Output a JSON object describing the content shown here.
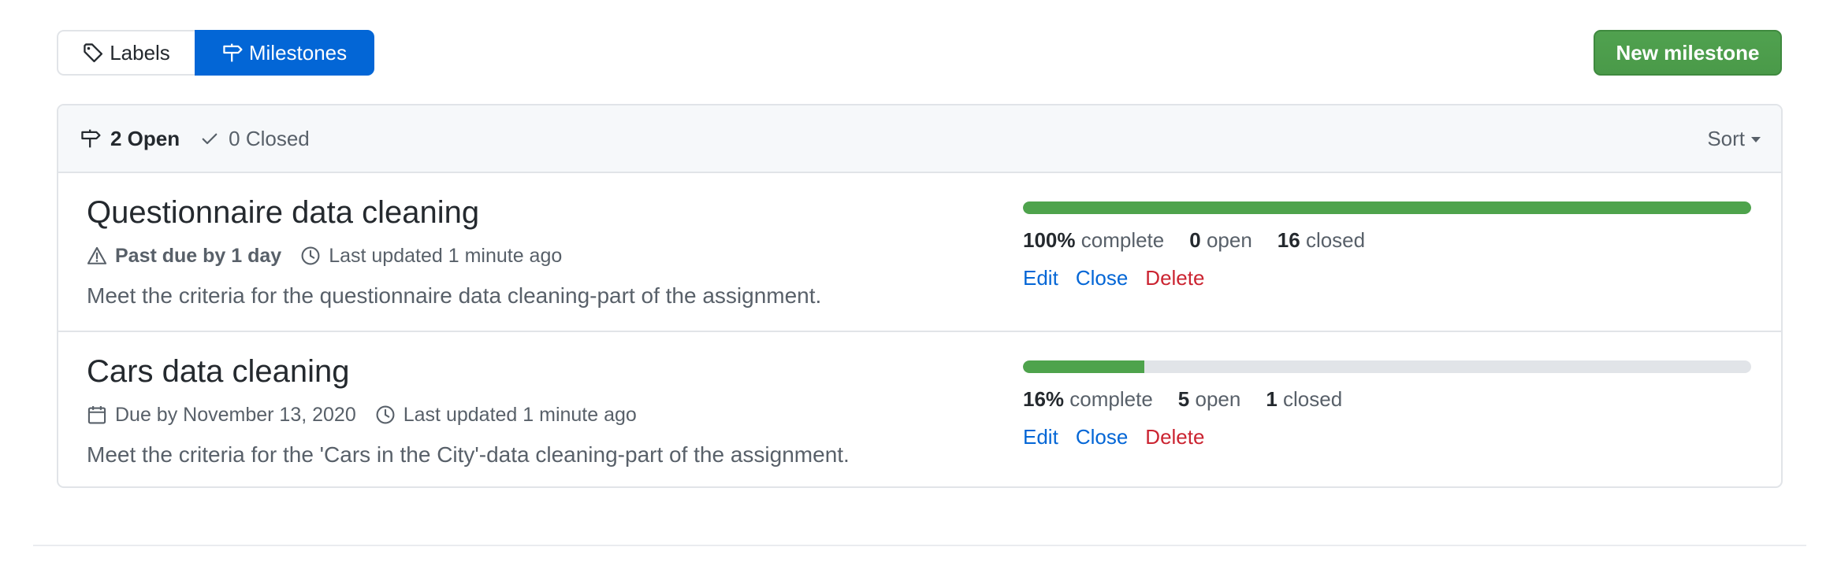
{
  "subnav": {
    "labels": "Labels",
    "milestones": "Milestones"
  },
  "new_milestone_label": "New milestone",
  "header": {
    "open_count": "2 Open",
    "closed_count": "0 Closed",
    "sort_label": "Sort"
  },
  "colors": {
    "accent": "#0366d6",
    "success": "#4ea34c",
    "danger": "#cb2431",
    "muted": "#586069"
  },
  "milestones": [
    {
      "title": "Questionnaire data cleaning",
      "status_icon": "alert-icon",
      "status_text": "Past due by 1 day",
      "updated_text": "Last updated 1 minute ago",
      "description": "Meet the criteria for the questionnaire data cleaning-part of the assignment.",
      "progress_percent": 100,
      "complete_value": "100%",
      "complete_label": "complete",
      "open_value": "0",
      "open_label": "open",
      "closed_value": "16",
      "closed_label": "closed",
      "actions": {
        "edit": "Edit",
        "close": "Close",
        "delete": "Delete"
      }
    },
    {
      "title": "Cars data cleaning",
      "status_icon": "calendar-icon",
      "status_text": "Due by November 13, 2020",
      "updated_text": "Last updated 1 minute ago",
      "description": "Meet the criteria for the 'Cars in the City'-data cleaning-part of the assignment.",
      "progress_percent": 16.7,
      "complete_value": "16%",
      "complete_label": "complete",
      "open_value": "5",
      "open_label": "open",
      "closed_value": "1",
      "closed_label": "closed",
      "actions": {
        "edit": "Edit",
        "close": "Close",
        "delete": "Delete"
      }
    }
  ]
}
